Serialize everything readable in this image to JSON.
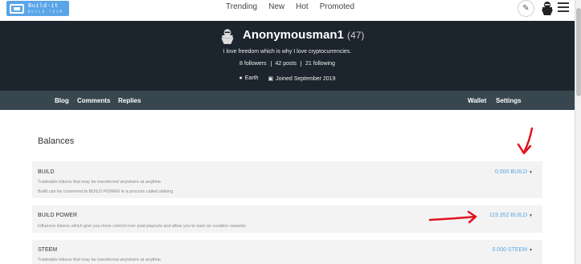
{
  "nav": {
    "logo_text": "Build-it",
    "logo_subtext": "BUILD TEAM",
    "links": [
      "Trending",
      "New",
      "Hot",
      "Promoted"
    ]
  },
  "profile": {
    "username": "Anonymousman1",
    "reputation": "(47)",
    "bio": "I love freedom which is why I love cryptocurrencies.",
    "followers": "8 followers",
    "posts": "42 posts",
    "following": "21 following",
    "location": "Earth",
    "joined": "Joined September 2019"
  },
  "subnav": {
    "left": [
      "Blog",
      "Comments",
      "Replies"
    ],
    "right": [
      "Wallet",
      "Settings"
    ]
  },
  "balances": {
    "title": "Balances",
    "rows": [
      {
        "name": "BUILD",
        "desc1": "Tradeable tokens that may be transferred anywhere at anytime.",
        "desc2": "Build can be converted to BUILD POWER in a process called staking.",
        "value": "0.000 BUILD"
      },
      {
        "name": "BUILD POWER",
        "desc1": "Influence tokens which give you more control over post payouts and allow you to earn on curation rewards.",
        "desc2": "",
        "value": "119.352 BUILD"
      },
      {
        "name": "STEEM",
        "desc1": "Tradeable tokens that may be transferred anywhere at anytime.",
        "desc2": "",
        "value": "0.000 STEEM"
      }
    ]
  },
  "colors": {
    "hero_bg": "#1c252d",
    "subnav_bg": "#37464f",
    "accent": "#5aa5e8",
    "annotation": "#e0141e"
  },
  "icons": [
    "pencil-icon",
    "hamburger-menu-icon",
    "location-pin-icon",
    "calendar-icon",
    "caret-down-icon"
  ]
}
